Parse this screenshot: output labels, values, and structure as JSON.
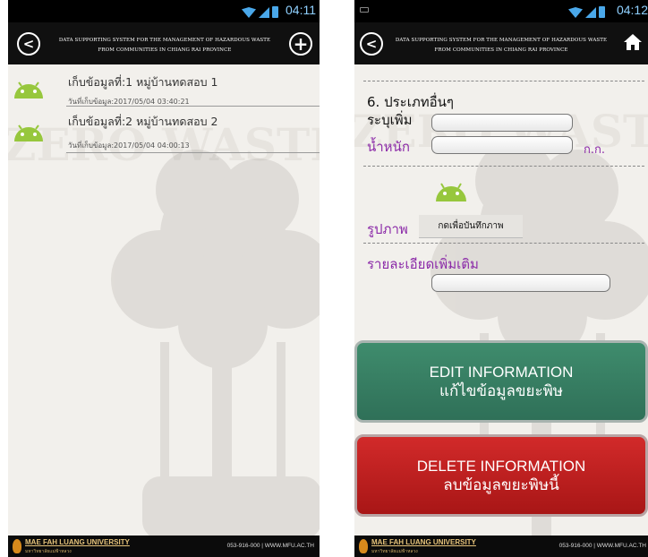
{
  "colors": {
    "app_bar": "#101010",
    "edit_button": "#347a60",
    "delete_button": "#c02020",
    "accent_purple": "#8b2aa8",
    "android_green": "#97c73d"
  },
  "left_screen": {
    "status_time": "04:11",
    "app_title_line1": "DATA SUPPORTING SYSTEM FOR THE MANAGEMENT OF HAZARDOUS WASTE",
    "app_title_line2": "FROM COMMUNITIES IN CHIANG RAI PROVINCE",
    "list": [
      {
        "title": "เก็บข้อมูลที่:1 หมู่บ้านทดสอบ 1",
        "date": "วันที่เก็บข้อมูล:2017/05/04 03:40:21",
        "icon": "android-icon"
      },
      {
        "title": "เก็บข้อมูลที่:2 หมู่บ้านทดสอบ 2",
        "date": "วันที่เก็บข้อมูล:2017/05/04 04:00:13",
        "icon": "android-icon"
      }
    ],
    "footer_university": "MAE FAH LUANG UNIVERSITY",
    "footer_university_th": "มหาวิทยาลัยแม่ฟ้าหลวง",
    "footer_contact": "053-916-000 | WWW.MFU.AC.TH"
  },
  "right_screen": {
    "status_time": "04:12",
    "app_title_line1": "DATA SUPPORTING SYSTEM FOR THE MANAGEMENT OF HAZARDOUS WASTE",
    "app_title_line2": "FROM COMMUNITIES IN CHIANG RAI PROVINCE",
    "section_title": "6. ประเภทอื่นๆ",
    "specify_label": "ระบุเพิ่ม",
    "specify_value": "",
    "weight_label": "น้ำหนัก",
    "weight_value": "",
    "weight_unit": "ก.ก.",
    "photo_label": "รูปภาพ",
    "photo_button": "กดเพื่อบันทึกภาพ",
    "details_label": "รายละเอียดเพิ่มเติม",
    "details_value": "",
    "edit_button_en": "EDIT INFORMATION",
    "edit_button_th": "แก้ไขข้อมูลขยะพิษ",
    "delete_button_en": "DELETE INFORMATION",
    "delete_button_th": "ลบข้อมูลขยะพิษนี้",
    "footer_university": "MAE FAH LUANG UNIVERSITY",
    "footer_university_th": "มหาวิทยาลัยแม่ฟ้าหลวง",
    "footer_contact": "053-916-000 | WWW.MFU.AC.TH"
  }
}
